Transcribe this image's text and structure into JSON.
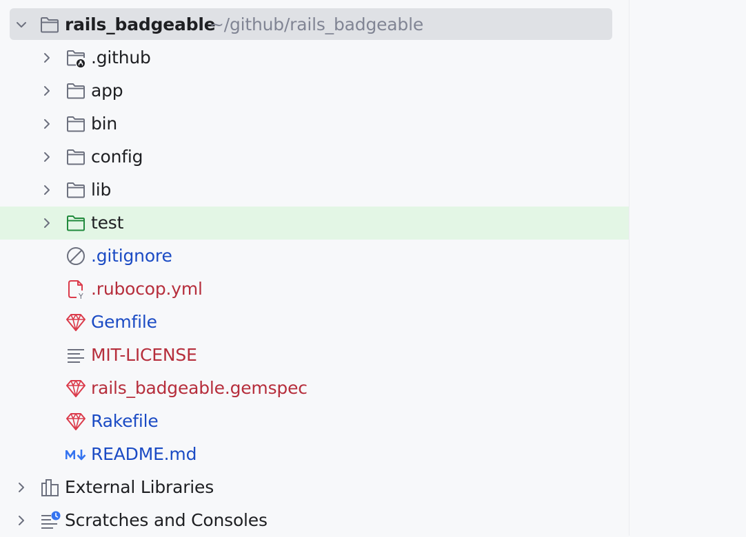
{
  "tree": {
    "root": {
      "name": "rails_badgeable",
      "path": "~/github/rails_badgeable",
      "expanded": true
    },
    "items": [
      {
        "label": ".github",
        "type": "folder-github",
        "color": "#1e1f22"
      },
      {
        "label": "app",
        "type": "folder",
        "color": "#1e1f22"
      },
      {
        "label": "bin",
        "type": "folder",
        "color": "#1e1f22"
      },
      {
        "label": "config",
        "type": "folder",
        "color": "#1e1f22"
      },
      {
        "label": "lib",
        "type": "folder",
        "color": "#1e1f22"
      },
      {
        "label": "test",
        "type": "folder-test",
        "color": "#1e1f22"
      },
      {
        "label": ".gitignore",
        "type": "ignore-file",
        "color": "#1b4bc4"
      },
      {
        "label": ".rubocop.yml",
        "type": "yaml-file",
        "color": "#b62e3c"
      },
      {
        "label": "Gemfile",
        "type": "ruby-gem",
        "color": "#1b4bc4"
      },
      {
        "label": "MIT-LICENSE",
        "type": "text-file",
        "color": "#b62e3c"
      },
      {
        "label": "rails_badgeable.gemspec",
        "type": "ruby-gem",
        "color": "#b62e3c"
      },
      {
        "label": "Rakefile",
        "type": "ruby-gem",
        "color": "#1b4bc4"
      },
      {
        "label": "README.md",
        "type": "markdown-file",
        "color": "#1b4bc4"
      }
    ],
    "bottom": [
      {
        "label": "External Libraries",
        "type": "libraries"
      },
      {
        "label": "Scratches and Consoles",
        "type": "scratches"
      }
    ]
  },
  "colors": {
    "background": "#f7f8fa",
    "selection": "#dfe1e5",
    "test_highlight": "#e3f6e5",
    "folder_stroke": "#6c707e",
    "test_folder_stroke": "#208a3c",
    "ruby_red": "#db3b4b",
    "markdown_blue": "#3574f0"
  }
}
